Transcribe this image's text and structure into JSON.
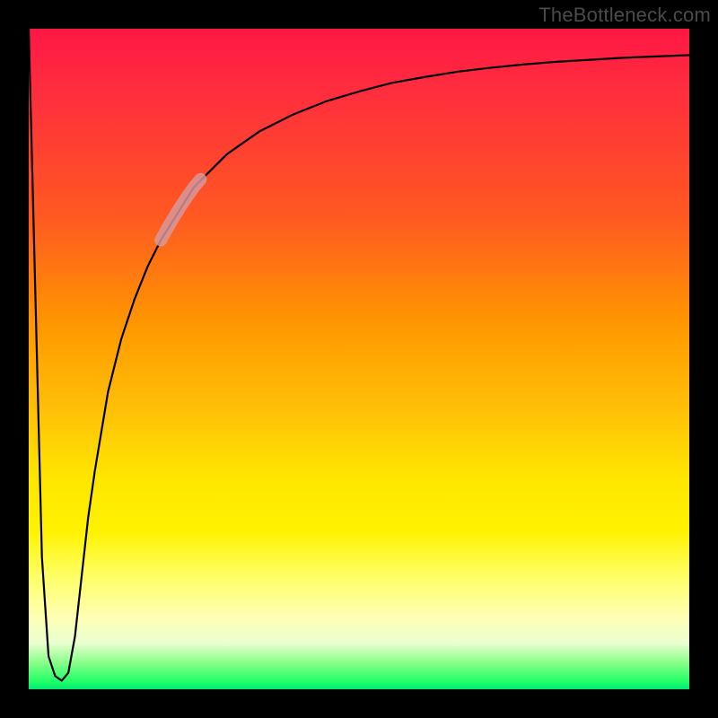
{
  "watermark": "TheBottleneck.com",
  "chart_data": {
    "type": "line",
    "title": "",
    "xlabel": "",
    "ylabel": "",
    "xlim": [
      0,
      100
    ],
    "ylim": [
      0,
      100
    ],
    "grid": false,
    "legend_position": "none",
    "annotations": [],
    "series": [
      {
        "name": "bottleneck-curve",
        "x": [
          0,
          1,
          2,
          3,
          4,
          5,
          6,
          7,
          8,
          9,
          10,
          12,
          14,
          16,
          18,
          20,
          25,
          30,
          35,
          40,
          45,
          50,
          55,
          60,
          65,
          70,
          75,
          80,
          85,
          90,
          95,
          100
        ],
        "y": [
          100,
          60,
          20,
          5,
          2.0,
          1.3,
          2.5,
          8,
          17,
          26,
          33,
          45,
          53,
          59,
          64,
          68,
          76,
          81,
          84.5,
          87,
          89,
          90.5,
          91.8,
          92.7,
          93.5,
          94.1,
          94.6,
          95.0,
          95.3,
          95.6,
          95.8,
          96.0
        ]
      },
      {
        "name": "highlight-segment",
        "x": [
          20,
          21,
          22,
          23,
          24,
          25,
          26
        ],
        "y": [
          68,
          69.8,
          71.5,
          73.1,
          74.6,
          76,
          77.2
        ]
      }
    ],
    "background_gradient_stops": [
      {
        "pos": 0.0,
        "color": "#ff1744"
      },
      {
        "pos": 0.28,
        "color": "#ff5722"
      },
      {
        "pos": 0.58,
        "color": "#ffc107"
      },
      {
        "pos": 0.76,
        "color": "#fff200"
      },
      {
        "pos": 0.93,
        "color": "#eaffd0"
      },
      {
        "pos": 1.0,
        "color": "#00e676"
      }
    ]
  }
}
